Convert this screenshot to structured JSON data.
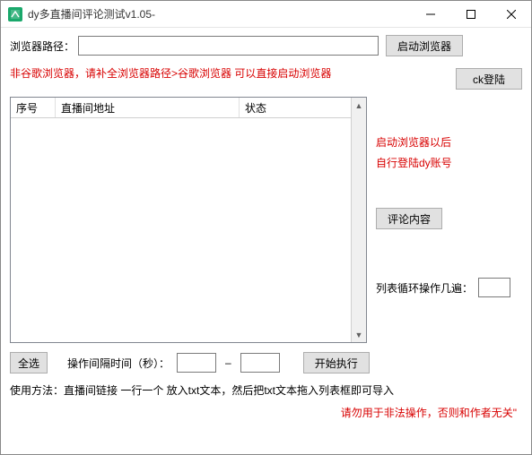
{
  "window": {
    "title": "dy多直播间评论测试v1.05-"
  },
  "browser": {
    "path_label": "浏览器路径：",
    "path_value": "",
    "launch_btn": "启动浏览器",
    "hint_nonchrome": "非谷歌浏览器，请补全浏览器路径>谷歌浏览器  可以直接启动浏览器",
    "ck_login_btn": "ck登陆"
  },
  "table": {
    "columns": {
      "seq": "序号",
      "url": "直播间地址",
      "status": "状态"
    },
    "rows": []
  },
  "side": {
    "after_launch": "启动浏览器以后",
    "self_login": "自行登陆dy账号",
    "comment_btn": "评论内容",
    "loop_label": "列表循环操作几遍：",
    "loop_value": ""
  },
  "bottom": {
    "select_all": "全选",
    "interval_label": "操作间隔时间（秒）：",
    "interval_min": "",
    "interval_max": "",
    "start_btn": "开始执行"
  },
  "usage": "使用方法：直播间链接  一行一个  放入txt文本，然后把txt文本拖入列表框即可导入",
  "warning": "请勿用于非法操作，否则和作者无关\""
}
